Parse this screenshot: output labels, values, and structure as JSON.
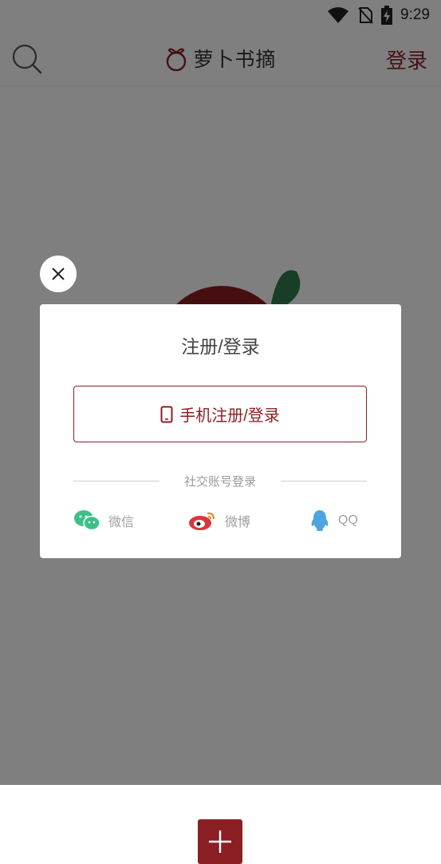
{
  "status_bar": {
    "time": "9:29"
  },
  "header": {
    "app_title": "萝卜书摘",
    "login_label": "登录"
  },
  "modal": {
    "title": "注册/登录",
    "phone_login_label": "手机注册/登录",
    "social_divider_label": "社交账号登录",
    "social": [
      {
        "name": "wechat",
        "label": "微信",
        "color": "#3cc08a"
      },
      {
        "name": "weibo",
        "label": "微博",
        "color": "#d9363e"
      },
      {
        "name": "qq",
        "label": "QQ",
        "color": "#4aa5e0"
      }
    ]
  },
  "colors": {
    "accent": "#8a1f24",
    "overlay": "rgba(0,0,0,0.5)",
    "leaf": "#2e7d4f"
  }
}
